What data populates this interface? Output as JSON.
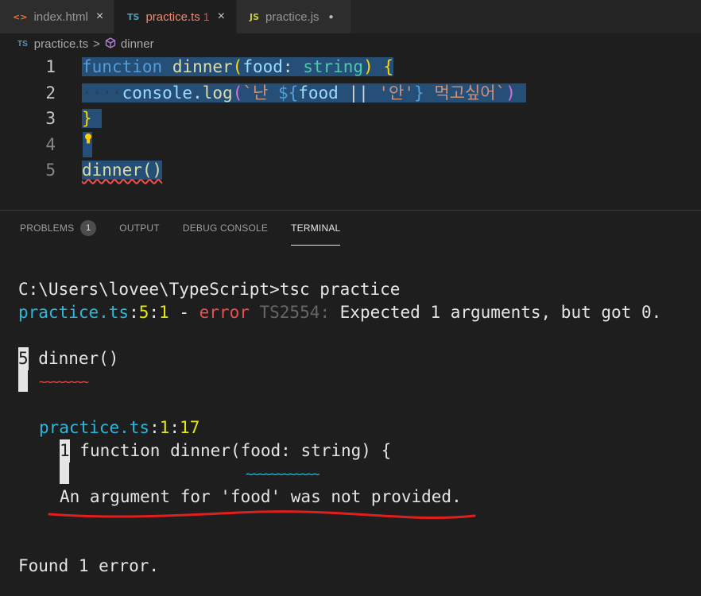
{
  "tabs": [
    {
      "icon": "<>",
      "label": "index.html",
      "close": "×"
    },
    {
      "icon": "TS",
      "label": "practice.ts",
      "badge": "1",
      "close": "×"
    },
    {
      "icon": "JS",
      "label": "practice.js",
      "dot": "●"
    }
  ],
  "breadcrumb": {
    "file_icon": "TS",
    "file": "practice.ts",
    "sep": ">",
    "symbol": "dinner"
  },
  "editor": {
    "line_numbers": [
      "1",
      "2",
      "3",
      "4",
      "5"
    ],
    "line1": {
      "kw": "function",
      "fn": "dinner",
      "p_open": "(",
      "param": "food",
      "colon": ": ",
      "type": "string",
      "p_close": ")",
      "brace": "{"
    },
    "line2": {
      "dots": "····",
      "obj": "console",
      "dot": ".",
      "method": "log",
      "p_open": "(",
      "tpl_start": "`난 ",
      "interp_open": "${",
      "var": "food",
      "op": " || ",
      "str": "'안'",
      "interp_close": "}",
      "tpl_end": " 먹고싶어`",
      "p_close": ")"
    },
    "line3": {
      "brace": "}"
    },
    "line5": {
      "call": "dinner()"
    }
  },
  "panel": {
    "tabs": [
      "PROBLEMS",
      "OUTPUT",
      "DEBUG CONSOLE",
      "TERMINAL"
    ],
    "problems_count": "1"
  },
  "terminal": {
    "prompt": "C:\\Users\\lovee\\TypeScript>tsc practice",
    "err_file": "practice.ts",
    "err_loc_sep": ":",
    "err_line": "5",
    "err_col": "1",
    "err_dash": " - ",
    "err_word": "error",
    "err_code": " TS2554:",
    "err_msg": " Expected 1 arguments, but got 0.",
    "snippet1_gutter": "5",
    "snippet1_code": " dinner()",
    "snippet1_squiggle": "~~~~~~~~",
    "related_file": "practice.ts",
    "related_line": "1",
    "related_col": "17",
    "snippet2_gutter": "1",
    "snippet2_code": " function dinner(food: string) {",
    "snippet2_squiggle": "~~~~~~~~~~~~",
    "related_msg": "An argument for 'food' was not provided.",
    "summary": "Found 1 error."
  },
  "colors": {
    "selection": "#264f78",
    "error": "#f14c4c",
    "cyan": "#29b8db",
    "yellow": "#e5e510"
  }
}
